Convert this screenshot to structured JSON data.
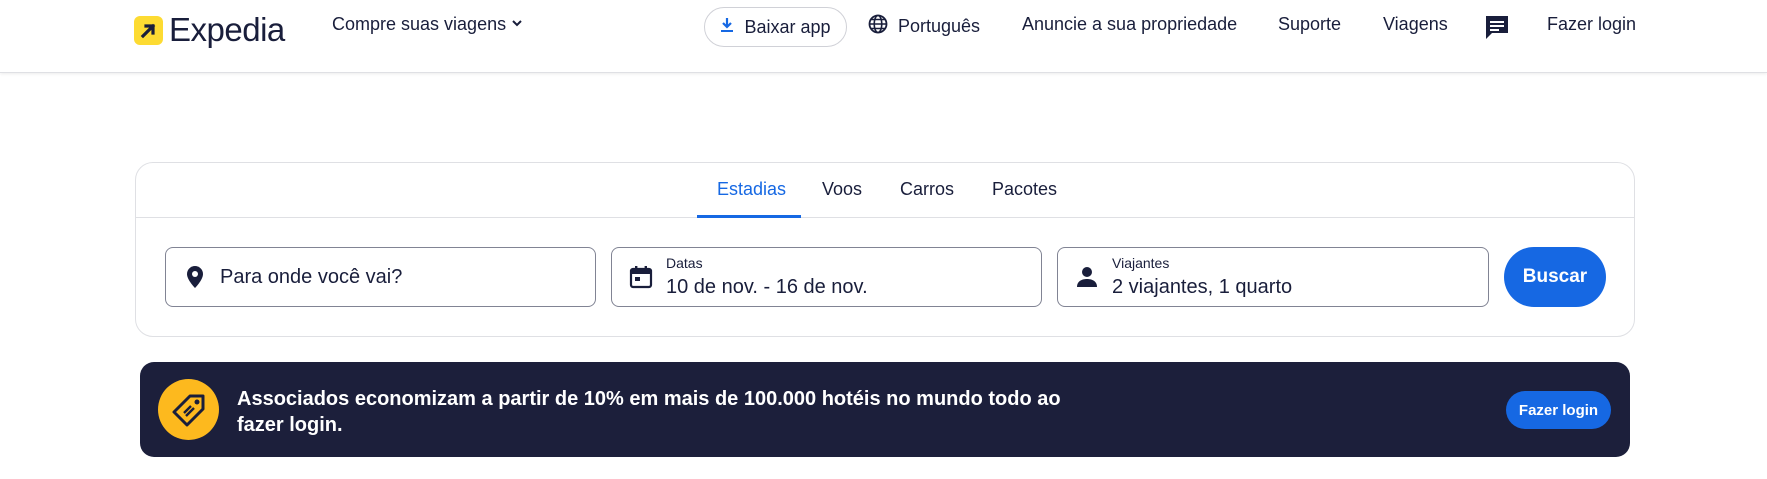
{
  "header": {
    "brand": "Expedia",
    "shop_menu": "Compre suas viagens",
    "download_app": "Baixar app",
    "language": "Português",
    "list_property": "Anuncie a sua propriedade",
    "support": "Suporte",
    "trips": "Viagens",
    "sign_in": "Fazer login"
  },
  "search": {
    "tabs": [
      {
        "label": "Estadias",
        "active": true
      },
      {
        "label": "Voos",
        "active": false
      },
      {
        "label": "Carros",
        "active": false
      },
      {
        "label": "Pacotes",
        "active": false
      }
    ],
    "destination": {
      "placeholder": "Para onde você vai?"
    },
    "dates": {
      "label": "Datas",
      "value": "10 de nov. - 16 de nov."
    },
    "travelers": {
      "label": "Viajantes",
      "value": "2 viajantes, 1 quarto"
    },
    "submit": "Buscar"
  },
  "banner": {
    "text": "Associados economizam a partir de 10% em mais de 100.000 hotéis no mundo todo ao fazer login.",
    "cta": "Fazer login"
  },
  "colors": {
    "brand_yellow": "#fddb32",
    "primary_blue": "#1668e3",
    "navy": "#191e3b",
    "banner_bg": "#1c1f3b",
    "badge_gold": "#fdb91e"
  },
  "icons": {
    "logo": "expedia-arrow-icon",
    "shop_menu": "chevron-down-icon",
    "download": "download-icon",
    "language": "globe-icon",
    "messages": "chat-icon",
    "destination": "location-pin-icon",
    "dates": "calendar-icon",
    "travelers": "person-icon",
    "banner": "price-tag-icon"
  }
}
